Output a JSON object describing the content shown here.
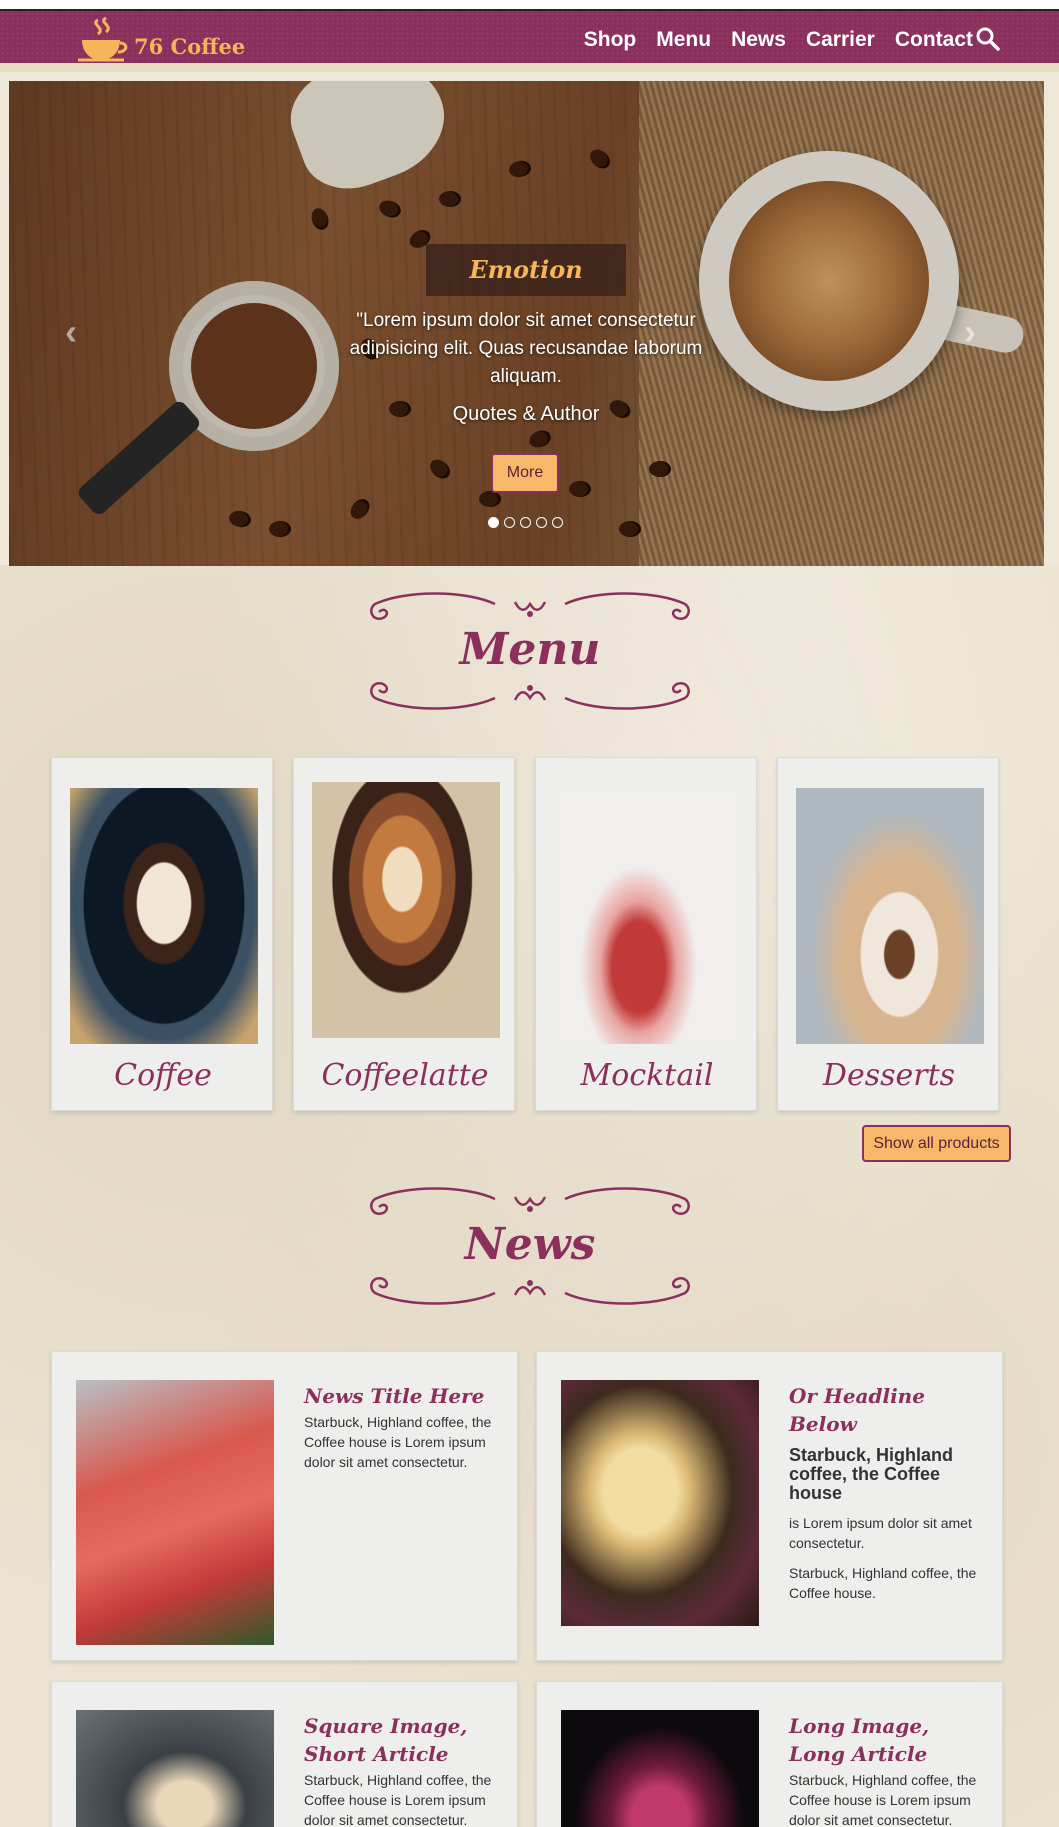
{
  "brand": {
    "name": "76 Coffee"
  },
  "nav": {
    "items": [
      "Shop",
      "Menu",
      "News",
      "Carrier",
      "Contact"
    ]
  },
  "hero": {
    "title": "Emotion",
    "quote": "\"Lorem ipsum dolor sit amet consectetur adipisicing elit. Quas recusandae laborum aliquam.",
    "author": "Quotes & Author",
    "button": "More",
    "slides": 5,
    "active_slide": 1
  },
  "menu_section": {
    "heading": "Menu",
    "items": [
      {
        "label": "Coffee"
      },
      {
        "label": "Coffeelatte"
      },
      {
        "label": "Mocktail"
      },
      {
        "label": "Desserts"
      }
    ],
    "show_all": "Show all products"
  },
  "news_section": {
    "heading": "News",
    "articles": [
      {
        "title": "News Title Here",
        "body": "Starbuck, Highland coffee, the Coffee house is Lorem ipsum dolor sit amet consectetur."
      },
      {
        "title": "Or Headline Below",
        "subtitle": "Starbuck, Highland coffee, the Coffee house",
        "p1": "is Lorem ipsum dolor sit amet consectetur.",
        "p2": "Starbuck, Highland coffee, the Coffee house."
      },
      {
        "title": "Square Image, Short Article",
        "body": "Starbuck, Highland coffee, the Coffee house is Lorem ipsum dolor sit amet consectetur."
      },
      {
        "title": "Long Image, Long Article",
        "body": "Starbuck, Highland coffee, the Coffee house is Lorem ipsum dolor sit amet consectetur."
      }
    ]
  },
  "colors": {
    "brand": "#8b2f5c",
    "accent": "#f7b969",
    "paper": "#ece4d3"
  }
}
